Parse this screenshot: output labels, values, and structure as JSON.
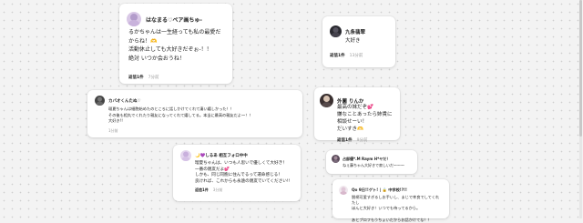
{
  "cards": [
    {
      "name": "はなまる♡ペア画ちゅ-",
      "body": "るかちゃんは一生経っても私の最愛だからね！🫶\n活動休止しても大好きだぞぉ-！！\n絶対 いつか会おうね！\n\n最愛 はなまるより",
      "reply_label": "返信1件",
      "time": "7分前",
      "avatar_color": "#d9c8e6"
    },
    {
      "name": "九条翡翠",
      "body": "大好き",
      "reply_label": "返信1件",
      "time": "13分前",
      "avatar_color": "#2a2a30"
    },
    {
      "name": "カバオくんたぬ♡",
      "body": "瑠夏ちゃんは細胞始めたのところに話しかけてくれて凄い嬉しかった！！\nその後も相丸でくれたり親友になってくれて嬉してる。本当に最高の親友だよ〜！！\n大好き!!",
      "reply_label": "",
      "time": "1分前",
      "avatar_color": "#444444"
    },
    {
      "name": "外薗 りんか",
      "body": "最高の妹だぞ💕\n嫌なことあったら姉貴に相談せーい！\nだいすき🫶",
      "reply_label": "返信1件",
      "time": "9分前",
      "avatar_color": "#3a3030"
    },
    {
      "name": "🌙💜しるあ 相互フォロ中中",
      "body": "瑠夏ちゃんは、いつも人思いで優しくて大好き！\n一番の親友だよ💕\nしかも、同じ同胞に住んでるって運命感じる！\n良ければ、これからも永遠の親友でいてください!!",
      "reply_label": "返信1件",
      "time": "3分前",
      "avatar_color": "#e4d6ee"
    },
    {
      "name": "占部優*.M Raym H*ヤだ！",
      "body": "ねぇ藤ちゃん大好きで寂しいだ〜〜〜",
      "reply_label": "",
      "time": "",
      "avatar_color": "#5a4a5a"
    },
    {
      "name": "Qo 9日!!ゲト! | 🔒 中学校!?!!",
      "body": "脱柄可愛すぎるしお手いし、まじで幸良でしてくれたし\nほんと大好き！いつでも待ってるから。\n\nあとプロフもうちょいだからお話かけてな！！",
      "reply_label": "",
      "time": "",
      "avatar_color": "#f0e8ee"
    }
  ]
}
